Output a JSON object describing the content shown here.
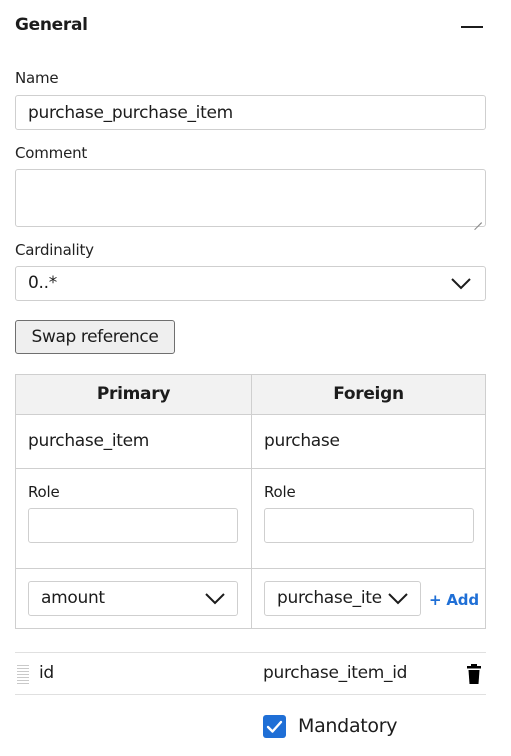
{
  "section": {
    "title": "General"
  },
  "name": {
    "label": "Name",
    "value": "purchase_purchase_item"
  },
  "comment": {
    "label": "Comment",
    "value": ""
  },
  "cardinality": {
    "label": "Cardinality",
    "value": "0..*"
  },
  "swap_button": "Swap reference",
  "table": {
    "headers": [
      "Primary",
      "Foreign"
    ],
    "primary_table": "purchase_item",
    "foreign_table": "purchase",
    "role_label_primary": "Role",
    "role_label_foreign": "Role",
    "primary_role": "",
    "foreign_role": "",
    "primary_column_select": "amount",
    "foreign_column_select": "purchase_ite",
    "add_label": "+ Add"
  },
  "pair": {
    "primary_column": "id",
    "foreign_column": "purchase_item_id"
  },
  "mandatory": {
    "label": "Mandatory",
    "checked": true
  },
  "colors": {
    "accent": "#1f6fd6",
    "header_bg": "#f2f2f2",
    "border": "#cfcfcf"
  }
}
